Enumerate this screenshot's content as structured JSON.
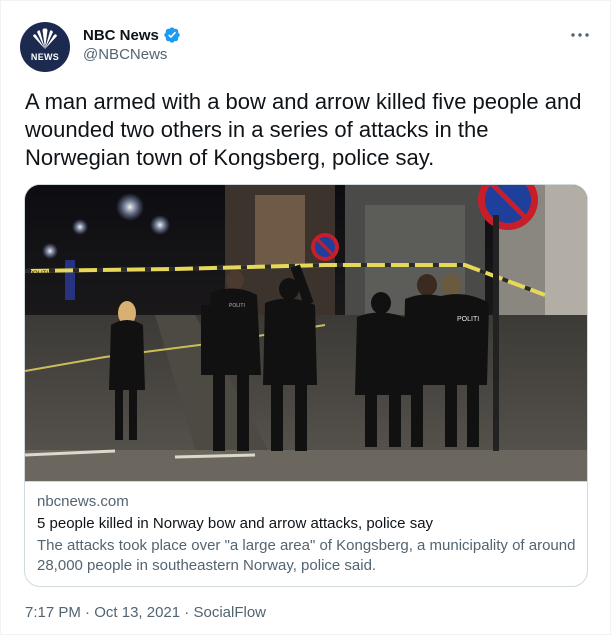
{
  "author": {
    "display_name": "NBC News",
    "handle": "@NBCNews",
    "avatar_text": "NEWS",
    "verified": true
  },
  "tweet": {
    "text": "A man armed with a bow and arrow killed five people and wounded two others in a series of attacks in the Norwegian town of Kongsberg, police say."
  },
  "card": {
    "domain": "nbcnews.com",
    "title": "5 people killed in Norway bow and arrow attacks, police say",
    "description": "The attacks took place over \"a large area\" of Kongsberg, a municipality of around 28,000 people in southeastern Norway, police said.",
    "image_tape_text": "POLITI",
    "image_vest_text": "POLITI"
  },
  "meta": {
    "time": "7:17 PM",
    "separator": "·",
    "date": "Oct 13, 2021",
    "source": "SocialFlow"
  },
  "icons": {
    "more": "more-options-icon",
    "verified": "verified-badge-icon",
    "avatar_logo": "peacock-logo"
  },
  "colors": {
    "text_primary": "#0f1419",
    "text_secondary": "#536471",
    "verified_blue": "#1d9bf0",
    "border": "#cfd9de"
  }
}
